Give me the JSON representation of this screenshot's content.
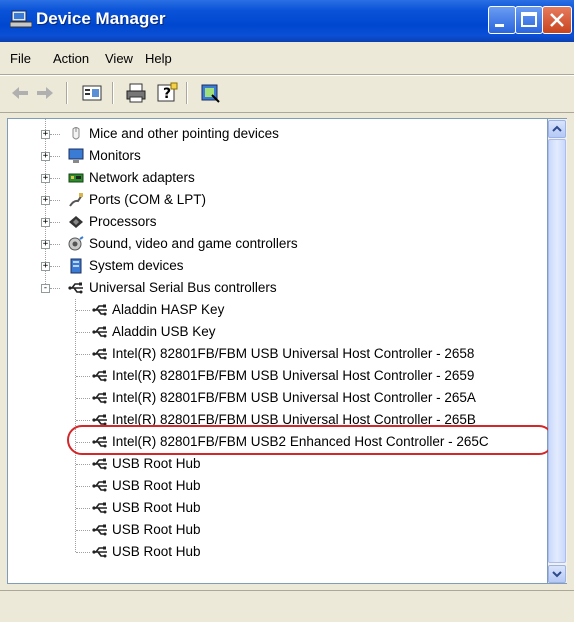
{
  "window": {
    "title": "Device Manager",
    "icons": {
      "title_icon": "device-manager-icon",
      "minimize": "minimize-icon",
      "maximize": "maximize-icon",
      "close": "close-icon"
    }
  },
  "menu": {
    "items": [
      "File",
      "Action",
      "View",
      "Help"
    ]
  },
  "toolbar": {
    "buttons": [
      "back-icon",
      "forward-icon",
      "properties-icon",
      "print-icon",
      "help-icon",
      "scan-hardware-icon"
    ]
  },
  "tree": {
    "items": [
      {
        "label": "Mice and other pointing devices",
        "icon": "mouse-icon",
        "expander": "+"
      },
      {
        "label": "Monitors",
        "icon": "monitor-icon",
        "expander": "+"
      },
      {
        "label": "Network adapters",
        "icon": "network-adapter-icon",
        "expander": "+"
      },
      {
        "label": "Ports (COM & LPT)",
        "icon": "port-icon",
        "expander": "+"
      },
      {
        "label": "Processors",
        "icon": "processor-icon",
        "expander": "+"
      },
      {
        "label": "Sound, video and game controllers",
        "icon": "sound-icon",
        "expander": "+"
      },
      {
        "label": "System devices",
        "icon": "system-device-icon",
        "expander": "+"
      },
      {
        "label": "Universal Serial Bus controllers",
        "icon": "usb-icon",
        "expander": "-"
      }
    ],
    "usb_children": [
      "Aladdin HASP Key",
      "Aladdin USB Key",
      "Intel(R) 82801FB/FBM USB Universal Host Controller - 2658",
      "Intel(R) 82801FB/FBM USB Universal Host Controller - 2659",
      "Intel(R) 82801FB/FBM USB Universal Host Controller - 265A",
      "Intel(R) 82801FB/FBM USB Universal Host Controller - 265B",
      "Intel(R) 82801FB/FBM USB2 Enhanced Host Controller - 265C",
      "USB Root Hub",
      "USB Root Hub",
      "USB Root Hub",
      "USB Root Hub",
      "USB Root Hub"
    ],
    "highlighted_item": "Intel(R) 82801FB/FBM USB2 Enhanced Host Controller - 265C"
  },
  "colors": {
    "titlebar": "#0047cf",
    "highlight_ring": "#d3272a",
    "chrome": "#ece9d8"
  }
}
